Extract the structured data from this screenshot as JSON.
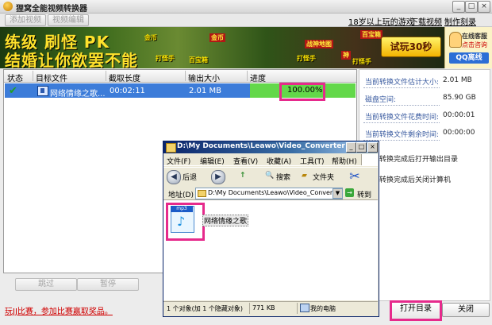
{
  "app": {
    "title": "狸窝全能视频转换器",
    "toolbar": {
      "add_video": "添加视频",
      "video_edit": "视频编辑"
    },
    "top_links": [
      "18岁以上玩的游戏",
      "下载视频",
      "制作刻录DVD"
    ]
  },
  "banner": {
    "line1": "练级 刷怪 PK",
    "line2": "结婚让你欲罢不能",
    "tags": [
      "金币",
      "打怪手",
      "百宝箱",
      "打怪手",
      "金币",
      "百宝箱",
      "神",
      "打怪手",
      "战神地图"
    ],
    "cta": "试玩30秒",
    "service_line1": "在线客服",
    "service_line2": "点击咨询",
    "qq": "QQ离线"
  },
  "table": {
    "columns": [
      "状态",
      "目标文件",
      "截取长度",
      "输出大小",
      "进度"
    ],
    "rows": [
      {
        "target": "网络情缘之歌...",
        "length": "00:02:11",
        "size": "2.01 MB",
        "progress": "100.00%",
        "progress_value": 1.0
      }
    ]
  },
  "buttons": {
    "skip": "跳过",
    "pause": "暂停",
    "open_folder": "打开目录",
    "close": "关闭"
  },
  "promo": "玩JJ比赛，参加比赛赢取奖品。",
  "info": {
    "rows": [
      {
        "label": "当前转换文件估计大小:",
        "value": "2.01 MB"
      },
      {
        "label": "磁盘空间:",
        "value": "85.90 GB"
      },
      {
        "label": "当前转换文件花费时间:",
        "value": "00:00:01"
      },
      {
        "label": "当前转换文件剩余时间:",
        "value": "00:00:00"
      }
    ],
    "options": [
      "转换完成后打开输出目录",
      "转换完成后关闭计算机"
    ]
  },
  "explorer": {
    "title": "D:\\My Documents\\Leawo\\Video_Converter",
    "menu": [
      "文件(F)",
      "编辑(E)",
      "查看(V)",
      "收藏(A)",
      "工具(T)",
      "帮助(H)"
    ],
    "toolbar": {
      "back": "后退",
      "search": "搜索",
      "folders": "文件夹"
    },
    "address_label": "地址(D)",
    "address": "D:\\My Documents\\Leawo\\Video_Converter",
    "go": "转到",
    "file_name": "网络情缘之歌",
    "file_tag": "mp3",
    "status": {
      "objects": "1 个对象(加 1 个隐藏对象)",
      "size": "771 KB",
      "location": "我的电脑"
    }
  },
  "colors": {
    "highlight": "#e62a8c",
    "row_selected": "#3c7cd9",
    "progress_fill": "#63d84a",
    "promo": "#d00000"
  }
}
